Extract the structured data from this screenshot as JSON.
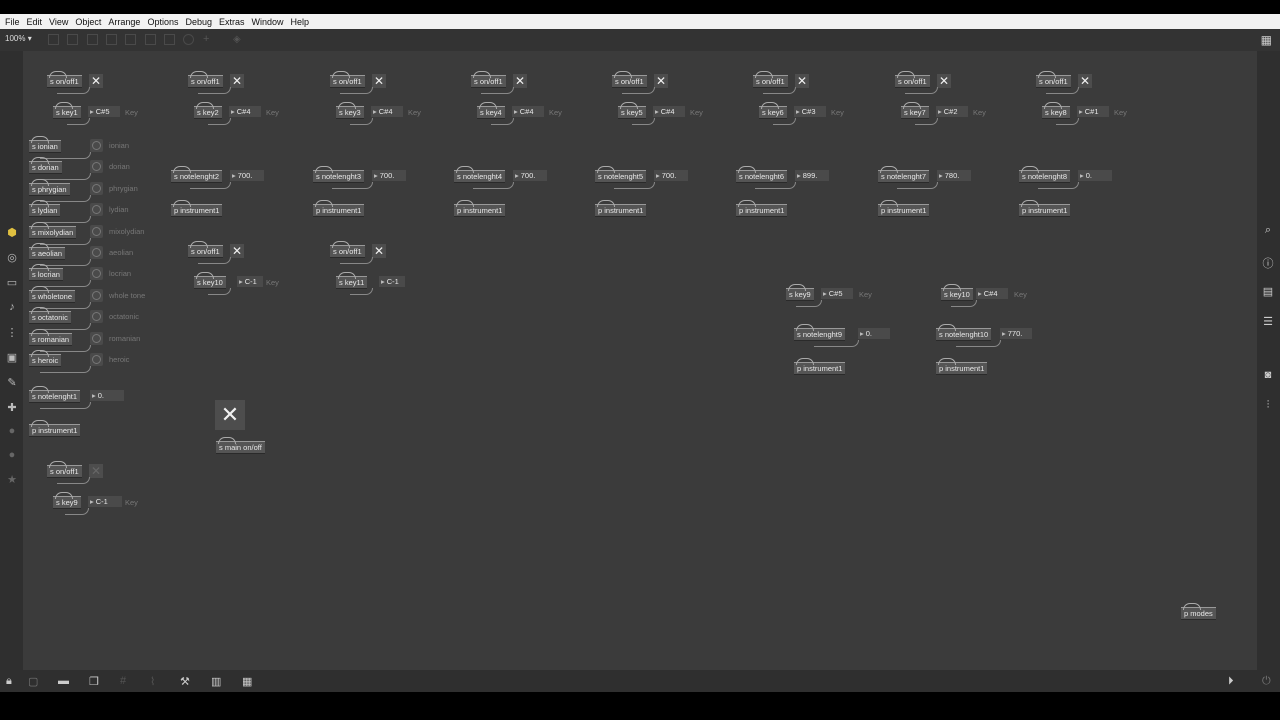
{
  "menu": [
    "File",
    "Edit",
    "View",
    "Object",
    "Arrange",
    "Options",
    "Debug",
    "Extras",
    "Window",
    "Help"
  ],
  "zoom": "100%",
  "key_label": "Key",
  "top_groups": [
    {
      "onoff": "s on/off1",
      "key": "s key1",
      "note": "C#5",
      "nl": "",
      "nl_val": "",
      "instr": ""
    },
    {
      "onoff": "s on/off1",
      "key": "s key2",
      "note": "C#4",
      "nl": "s notelenght2",
      "nl_val": "700.",
      "instr": "p instrument1"
    },
    {
      "onoff": "s on/off1",
      "key": "s key3",
      "note": "C#4",
      "nl": "s notelenght3",
      "nl_val": "700.",
      "instr": "p instrument1"
    },
    {
      "onoff": "s on/off1",
      "key": "s key4",
      "note": "C#4",
      "nl": "s notelenght4",
      "nl_val": "700.",
      "instr": "p instrument1"
    },
    {
      "onoff": "s on/off1",
      "key": "s key5",
      "note": "C#4",
      "nl": "s notelenght5",
      "nl_val": "700.",
      "instr": "p instrument1"
    },
    {
      "onoff": "s on/off1",
      "key": "s key6",
      "note": "C#3",
      "nl": "s notelenght6",
      "nl_val": "899.",
      "instr": "p instrument1"
    },
    {
      "onoff": "s on/off1",
      "key": "s key7",
      "note": "C#2",
      "nl": "s notelenght7",
      "nl_val": "780.",
      "instr": "p instrument1"
    },
    {
      "onoff": "s on/off1",
      "key": "s key8",
      "note": "C#1",
      "nl": "s notelenght8",
      "nl_val": "0.",
      "instr": "p instrument1"
    }
  ],
  "modes": [
    {
      "send": "s ionian",
      "label": "ionian"
    },
    {
      "send": "s dorian",
      "label": "dorian"
    },
    {
      "send": "s phrygian",
      "label": "phrygian"
    },
    {
      "send": "s lydian",
      "label": "lydian"
    },
    {
      "send": "s mixolydian",
      "label": "mixolydian"
    },
    {
      "send": "s aeolian",
      "label": "aeolian"
    },
    {
      "send": "s locrian",
      "label": "locrian"
    },
    {
      "send": "s wholetone",
      "label": "whole tone"
    },
    {
      "send": "s octatonic",
      "label": "octatonic"
    },
    {
      "send": "s romanian",
      "label": "romanian"
    },
    {
      "send": "s heroic",
      "label": "heroic"
    }
  ],
  "nl1": {
    "send": "s notelenght1",
    "val": "0.",
    "instr": "p instrument1"
  },
  "mid_groups": [
    {
      "onoff": "s on/off1",
      "key": "s key10",
      "note": "C-1"
    },
    {
      "onoff": "s on/off1",
      "key": "s key11",
      "note": "C-1"
    }
  ],
  "right_groups": [
    {
      "key": "s key9",
      "note": "C#5",
      "nl": "s notelenght9",
      "nl_val": "0.",
      "instr": "p instrument1"
    },
    {
      "key": "s key10",
      "note": "C#4",
      "nl": "s notelenght10",
      "nl_val": "770.",
      "instr": "p instrument1"
    }
  ],
  "main_onoff": "s main on/off",
  "bottom_group": {
    "onoff": "s on/off1",
    "key": "s key9",
    "note": "C-1"
  },
  "p_modes": "p modes"
}
